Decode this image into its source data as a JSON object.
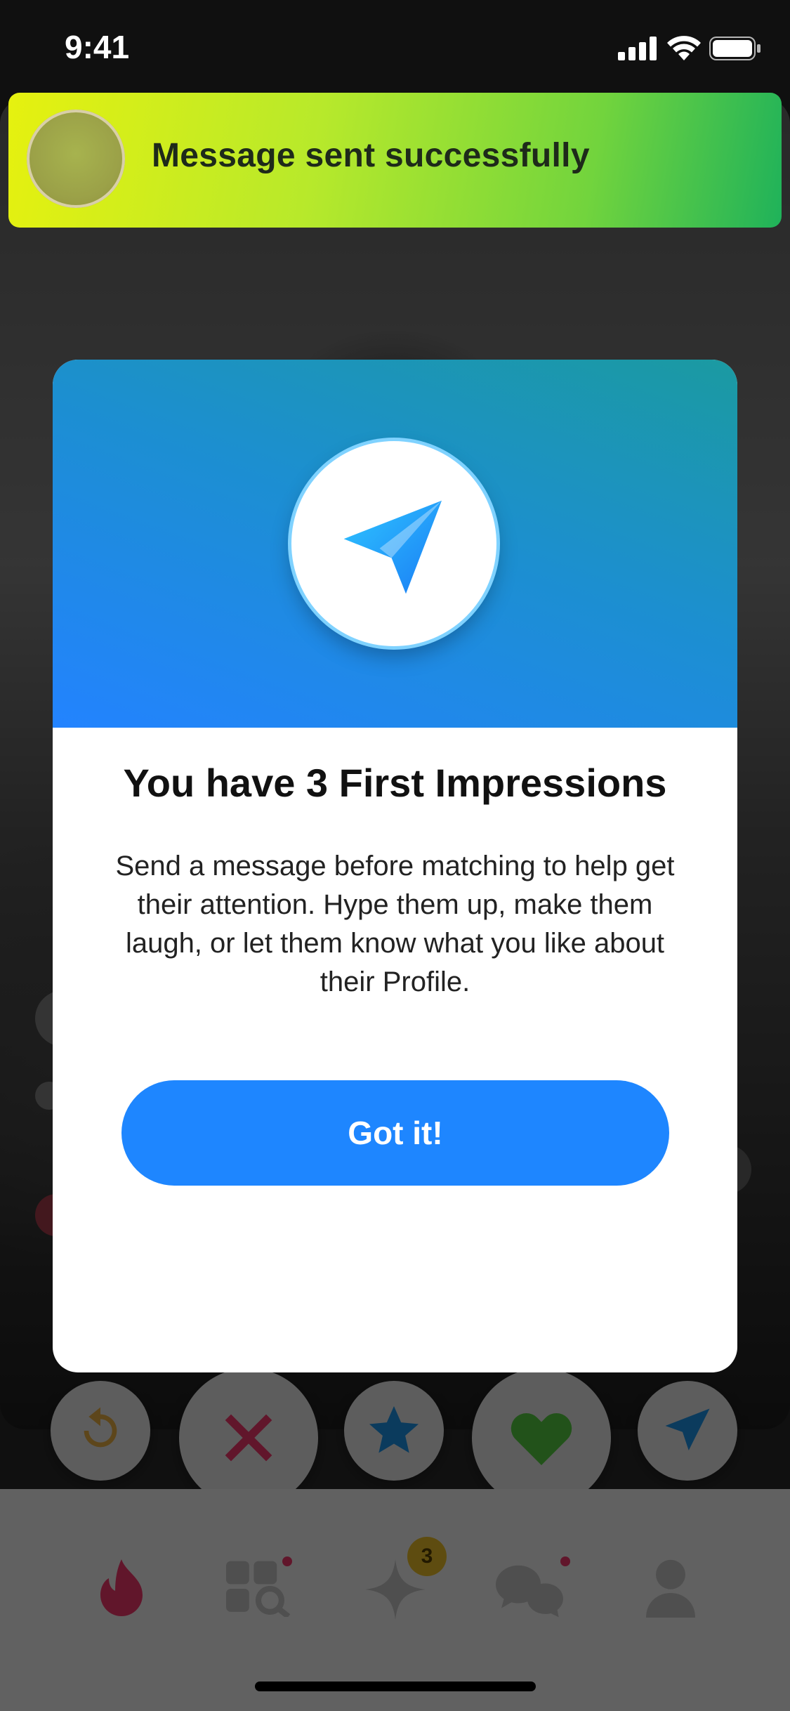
{
  "status_bar": {
    "time": "9:41"
  },
  "toast": {
    "message": "Message sent successfully"
  },
  "modal": {
    "title": "You have 3 First Impressions",
    "body": "Send a message before matching to help get their attention. Hype them up, make them laugh, or let them know what you like about their Profile.",
    "button_label": "Got it!",
    "icon": "paper-plane-icon"
  },
  "action_buttons": [
    "rewind-icon",
    "nope-icon",
    "super-like-icon",
    "like-icon",
    "first-impression-icon"
  ],
  "tab_bar": {
    "items": [
      {
        "name": "flame-icon"
      },
      {
        "name": "explore-icon",
        "dot": true
      },
      {
        "name": "gold-icon",
        "badge": "3"
      },
      {
        "name": "messages-icon",
        "dot": true
      },
      {
        "name": "profile-icon"
      }
    ]
  },
  "colors": {
    "accent_blue": "#1e86ff",
    "toast_gradient_start": "#e6f10f",
    "toast_gradient_end": "#1fb25a",
    "tinder_red": "#fe3c72"
  }
}
